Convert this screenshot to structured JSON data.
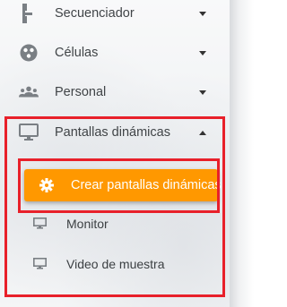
{
  "menu": {
    "items": [
      {
        "label": "Secuenciador",
        "icon": "sequencer-icon",
        "caret": "down"
      },
      {
        "label": "Células",
        "icon": "cells-icon",
        "caret": "down"
      },
      {
        "label": "Personal",
        "icon": "people-icon",
        "caret": "down"
      },
      {
        "label": "Pantallas dinámicas",
        "icon": "monitor-icon",
        "caret": "up"
      }
    ],
    "submenu": {
      "active": {
        "label": "Crear pantallas dinámicas",
        "icon": "gear-icon"
      },
      "items": [
        {
          "label": "Monitor",
          "icon": "monitor-icon"
        },
        {
          "label": "Video de muestra",
          "icon": "monitor-icon"
        }
      ]
    }
  },
  "colors": {
    "accent": "#ff9800",
    "highlight": "#e8202a",
    "text": "#404447",
    "icon": "#7a7f84"
  }
}
